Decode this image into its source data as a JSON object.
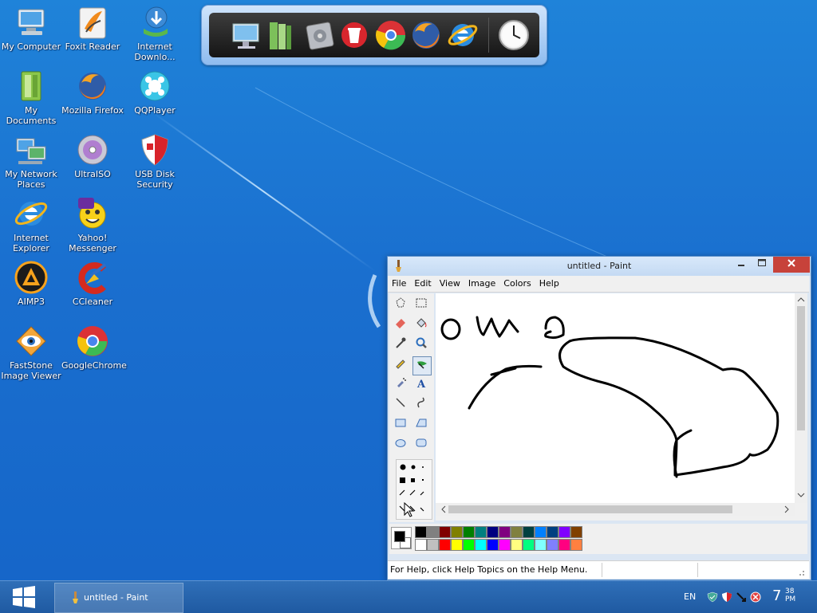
{
  "desktop": {
    "icons": [
      {
        "id": "my-computer",
        "label": "My Computer"
      },
      {
        "id": "foxit-reader",
        "label": "Foxit Reader"
      },
      {
        "id": "internet-download-manager",
        "label": "Internet Downlo..."
      },
      {
        "id": "my-documents",
        "label": "My Documents"
      },
      {
        "id": "mozilla-firefox",
        "label": "Mozilla Firefox"
      },
      {
        "id": "qqplayer",
        "label": "QQPlayer"
      },
      {
        "id": "my-network-places",
        "label": "My Network Places"
      },
      {
        "id": "ultraiso",
        "label": "UltraISO"
      },
      {
        "id": "usb-disk-security",
        "label": "USB Disk Security"
      },
      {
        "id": "internet-explorer",
        "label": "Internet Explorer"
      },
      {
        "id": "yahoo-messenger",
        "label": "Yahoo! Messenger"
      },
      {
        "id": "aimp3",
        "label": "AIMP3"
      },
      {
        "id": "ccleaner",
        "label": "CCleaner"
      },
      {
        "id": "faststone-image-viewer",
        "label": "FastStone Image Viewer"
      },
      {
        "id": "google-chrome",
        "label": "GoogleChrome"
      }
    ]
  },
  "dock": {
    "items": [
      "monitor-icon",
      "library-icon",
      "settings-disc-icon",
      "recycle-bin-icon",
      "chrome-icon",
      "firefox-icon",
      "internet-explorer-icon",
      "clock-icon"
    ]
  },
  "paint": {
    "title": "untitled - Paint",
    "menu": [
      "File",
      "Edit",
      "View",
      "Image",
      "Colors",
      "Help"
    ],
    "status": "For Help, click Help Topics on the Help Menu.",
    "palette_top": [
      "#000000",
      "#808080",
      "#800000",
      "#808000",
      "#008000",
      "#008080",
      "#000080",
      "#800080",
      "#808040",
      "#004040",
      "#0080ff",
      "#004080",
      "#8000ff",
      "#804000"
    ],
    "palette_bottom": [
      "#ffffff",
      "#c0c0c0",
      "#ff0000",
      "#ffff00",
      "#00ff00",
      "#00ffff",
      "#0000ff",
      "#ff00ff",
      "#ffff80",
      "#00ff80",
      "#80ffff",
      "#8080ff",
      "#ff0080",
      "#ff8040"
    ],
    "primary_color": "#000000",
    "secondary_color": "#ffffff"
  },
  "taskbar": {
    "start_icon": "windows-logo-icon",
    "task_label": "untitled - Paint",
    "language": "EN",
    "clock_hour": "7",
    "clock_minutes": "38",
    "clock_ampm": "PM"
  }
}
